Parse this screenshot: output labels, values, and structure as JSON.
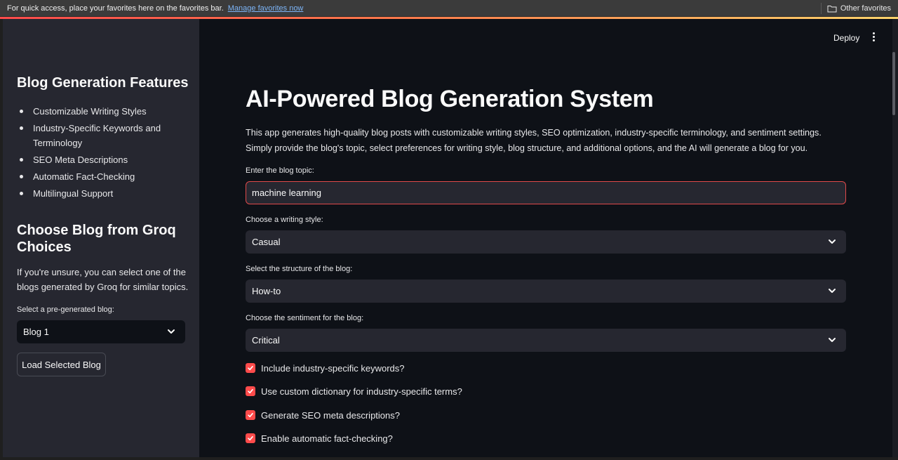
{
  "favorites_bar": {
    "message": "For quick access, place your favorites here on the favorites bar.",
    "link": "Manage favorites now",
    "other_favorites": "Other favorites"
  },
  "header": {
    "deploy_label": "Deploy"
  },
  "sidebar": {
    "features_title": "Blog Generation Features",
    "features": [
      "Customizable Writing Styles",
      "Industry-Specific Keywords and Terminology",
      "SEO Meta Descriptions",
      "Automatic Fact-Checking",
      "Multilingual Support"
    ],
    "choices_title": "Choose Blog from Groq Choices",
    "choices_description": "If you're unsure, you can select one of the blogs generated by Groq for similar topics.",
    "select_label": "Select a pre-generated blog:",
    "select_value": "Blog 1",
    "load_button": "Load Selected Blog"
  },
  "main": {
    "title": "AI-Powered Blog Generation System",
    "intro": "This app generates high-quality blog posts with customizable writing styles, SEO optimization, industry-specific terminology, and sentiment settings. Simply provide the blog's topic, select preferences for writing style, blog structure, and additional options, and the AI will generate a blog for you.",
    "topic": {
      "label": "Enter the blog topic:",
      "value": "machine learning"
    },
    "writing_style": {
      "label": "Choose a writing style:",
      "value": "Casual"
    },
    "structure": {
      "label": "Select the structure of the blog:",
      "value": "How-to"
    },
    "sentiment": {
      "label": "Choose the sentiment for the blog:",
      "value": "Critical"
    },
    "checkboxes": [
      {
        "label": "Include industry-specific keywords?",
        "checked": true
      },
      {
        "label": "Use custom dictionary for industry-specific terms?",
        "checked": true
      },
      {
        "label": "Generate SEO meta descriptions?",
        "checked": true
      },
      {
        "label": "Enable automatic fact-checking?",
        "checked": true
      }
    ]
  },
  "colors": {
    "accent": "#ff4b4b",
    "sidebar_bg": "#262730",
    "main_bg": "#0e1117"
  }
}
